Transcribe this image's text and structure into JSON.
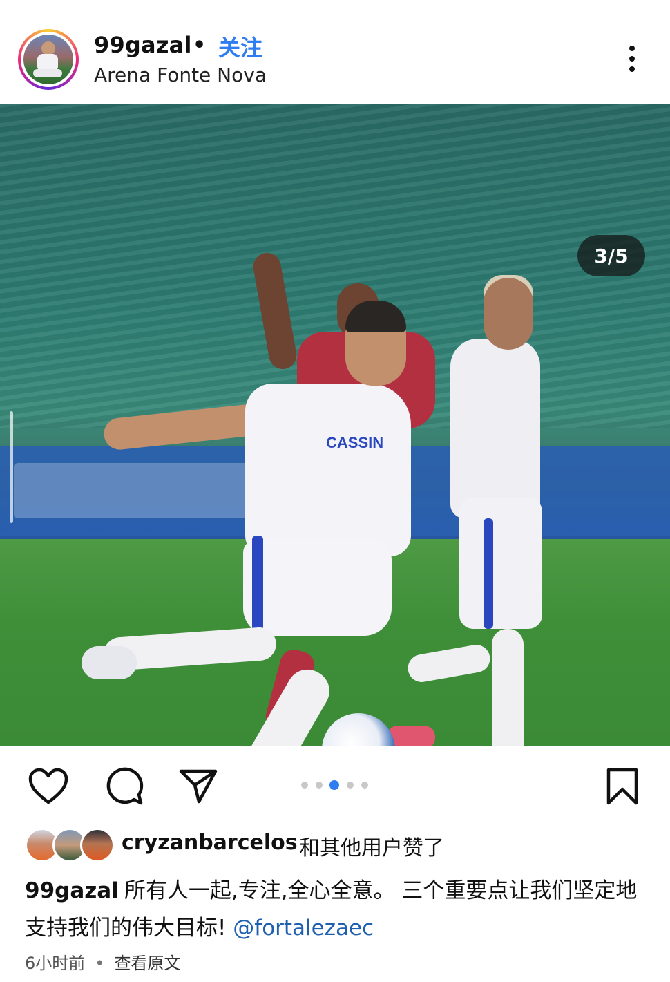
{
  "post": {
    "username": "99gazal",
    "separator": "•",
    "follow_label": "关注",
    "location": "Arena Fonte Nova",
    "image_counter": "3/5",
    "carousel": {
      "count": 5,
      "active_index": 2
    }
  },
  "photo": {
    "sponsor_text": "CASSIN"
  },
  "likes": {
    "user": "cryzanbarcelos",
    "text": "和其他用户赞了"
  },
  "caption": {
    "user": "99gazal",
    "text": "所有人一起,专注,全心全意。 三个重要点让我们坚定地支持我们的伟大目标! ",
    "mention": "@fortalezaec"
  },
  "meta": {
    "time": "6小时前",
    "separator": "•",
    "view_original": "查看原文"
  },
  "colors": {
    "follow": "#2f7df0",
    "active_dot": "#2f7df0",
    "mention": "#1f5fb0"
  },
  "icons": [
    "more-icon",
    "heart-icon",
    "comment-icon",
    "share-icon",
    "bookmark-icon"
  ]
}
